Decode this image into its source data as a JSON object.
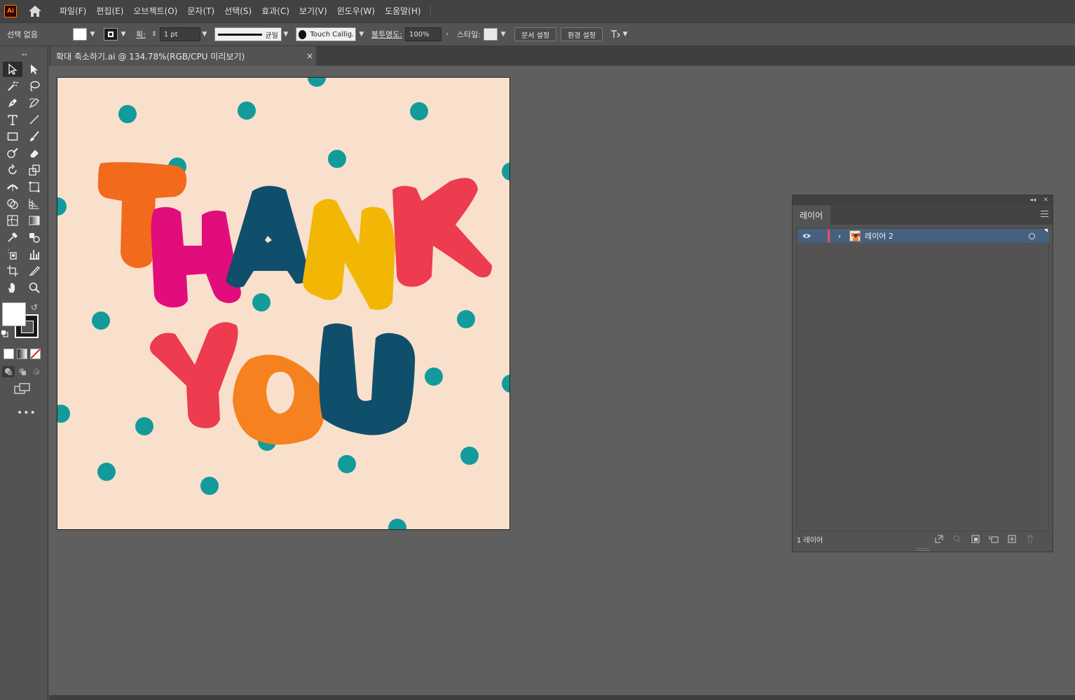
{
  "app": {
    "logo": "Ai"
  },
  "menu": [
    "파일(F)",
    "편집(E)",
    "오브젝트(O)",
    "문자(T)",
    "선택(S)",
    "효과(C)",
    "보기(V)",
    "윈도우(W)",
    "도움말(H)"
  ],
  "control": {
    "selection_label": "선택 없음",
    "stroke_label": "획:",
    "stroke_weight": "1 pt",
    "stroke_profile": "균일",
    "brush_name": "Touch Callig...",
    "opacity_label": "불투명도:",
    "opacity_value": "100%",
    "style_label": "스타일:",
    "doc_setup": "문서 설정",
    "preferences": "환경 설정"
  },
  "document": {
    "tab_title": "확대 축소하기.ai @ 134.78%(RGB/CPU 미리보기)",
    "close": "×"
  },
  "artwork": {
    "line1": [
      "T",
      "H",
      "A",
      "N",
      "K"
    ],
    "line2": [
      "Y",
      "O",
      "U"
    ],
    "colors": {
      "background": "#f9e0cc",
      "dots": "#139b9b",
      "orange": "#f26a1b",
      "pink": "#e20d7c",
      "navy": "#0f4f6b",
      "yellow": "#f2b705",
      "red": "#ed3b4f",
      "orange2": "#f5821f"
    }
  },
  "layers_panel": {
    "tab": "레이어",
    "layer_name": "레이어 2",
    "layer_count": "1 레이어"
  },
  "icons": {
    "home": "home-icon",
    "visibility": "eye-icon",
    "expand": "chevron-right-icon",
    "target": "target-icon"
  }
}
